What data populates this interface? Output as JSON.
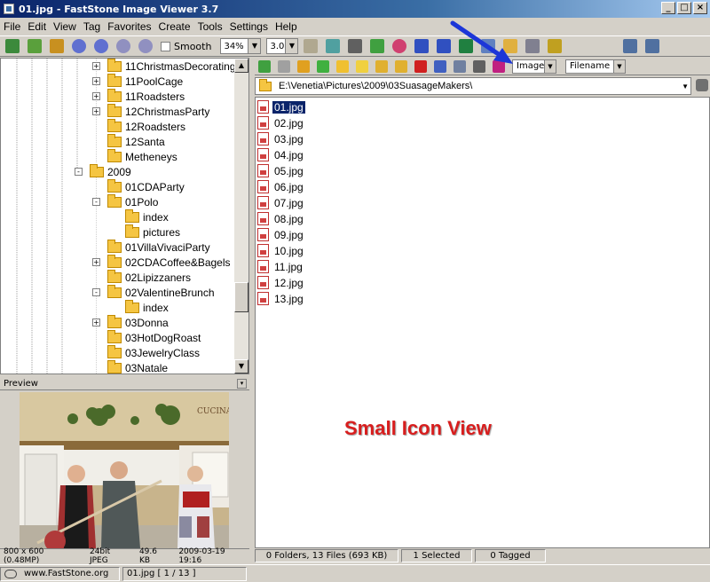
{
  "window": {
    "title": "01.jpg - FastStone Image Viewer 3.7",
    "buttons": [
      "_",
      "□",
      "×"
    ]
  },
  "menu": [
    "File",
    "Edit",
    "View",
    "Tag",
    "Favorites",
    "Create",
    "Tools",
    "Settings",
    "Help"
  ],
  "toolbar": {
    "smooth_label": "Smooth",
    "zoom_value": "34%",
    "zoom_step": "3.0"
  },
  "tree": [
    {
      "label": "11ChristmasDecorating",
      "expander": "+"
    },
    {
      "label": "11PoolCage",
      "expander": "+"
    },
    {
      "label": "11Roadsters",
      "expander": "+"
    },
    {
      "label": "12ChristmasParty",
      "expander": "+"
    },
    {
      "label": "12Roadsters",
      "expander": ""
    },
    {
      "label": "12Santa",
      "expander": ""
    },
    {
      "label": "Metheneys",
      "expander": ""
    },
    {
      "label": "2009",
      "expander": "-"
    },
    {
      "label": "01CDAParty",
      "expander": ""
    },
    {
      "label": "01Polo",
      "expander": "-"
    },
    {
      "label": "index",
      "expander": ""
    },
    {
      "label": "pictures",
      "expander": ""
    },
    {
      "label": "01VillaVivaciParty",
      "expander": ""
    },
    {
      "label": "02CDACoffee&Bagels",
      "expander": "+"
    },
    {
      "label": "02Lipizzaners",
      "expander": ""
    },
    {
      "label": "02ValentineBrunch",
      "expander": "-"
    },
    {
      "label": "index",
      "expander": ""
    },
    {
      "label": "03Donna",
      "expander": "+"
    },
    {
      "label": "03HotDogRoast",
      "expander": ""
    },
    {
      "label": "03JewelryClass",
      "expander": ""
    },
    {
      "label": "03Natale",
      "expander": ""
    }
  ],
  "preview": {
    "title": "Preview",
    "info": [
      "800 x 600 (0.48MP)",
      "24bit JPEG",
      "49.6 KB",
      "2009-03-19 19:16"
    ]
  },
  "right_toolbar": {
    "filter": "Images",
    "sort": "Filename"
  },
  "path": "E:\\Venetia\\Pictures\\2009\\03SuasageMakers\\",
  "files": [
    "01.jpg",
    "02.jpg",
    "03.jpg",
    "04.jpg",
    "05.jpg",
    "06.jpg",
    "07.jpg",
    "08.jpg",
    "09.jpg",
    "10.jpg",
    "11.jpg",
    "12.jpg",
    "13.jpg"
  ],
  "annotation": "Small Icon View",
  "status": {
    "counts": "0 Folders, 13 Files (693 KB)",
    "selected": "1 Selected",
    "tagged": "0 Tagged"
  },
  "bottom": {
    "site": "www.FastStone.org",
    "file_info": "01.jpg [ 1 / 13 ]"
  },
  "colors": {
    "title_bar": "#0a246a",
    "selection": "#0a246a",
    "annotation": "#d81e1e",
    "arrow": "#1c36d8"
  }
}
